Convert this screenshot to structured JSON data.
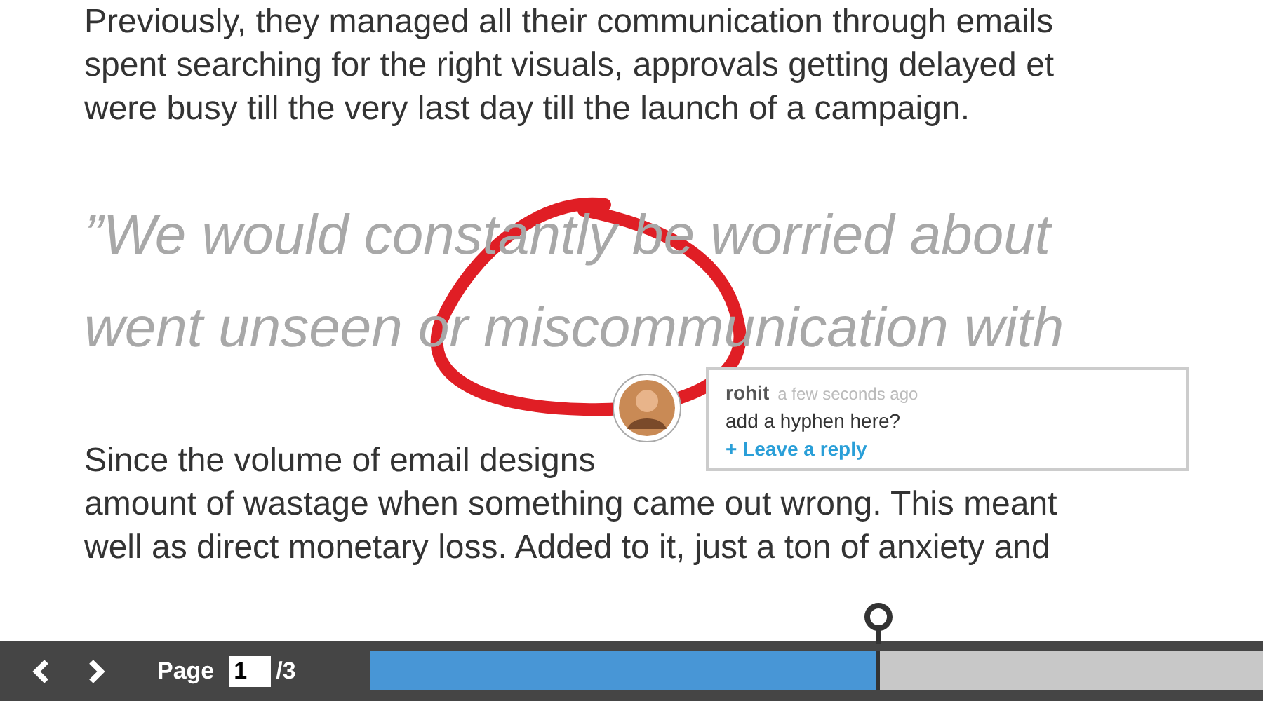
{
  "article": {
    "paragraph_1": [
      "Previously, they managed all their communication through emails",
      "spent searching for the right visuals, approvals getting delayed et",
      "were busy till the very last day till the launch of a campaign."
    ],
    "quote": [
      "”We would constantly be worried about",
      "went unseen or miscommunication with"
    ],
    "paragraph_2": [
      "Since the volume of email designs",
      "amount of wastage when something came out wrong. This meant",
      "well as direct monetary loss. Added to it, just a ton of anxiety and"
    ]
  },
  "comment": {
    "author": "rohit",
    "time": "a few seconds ago",
    "text": "add a hyphen here?",
    "reply_link": "+ Leave a reply"
  },
  "pager": {
    "label": "Page",
    "current": "1",
    "total": "/3",
    "level": 0.57
  }
}
